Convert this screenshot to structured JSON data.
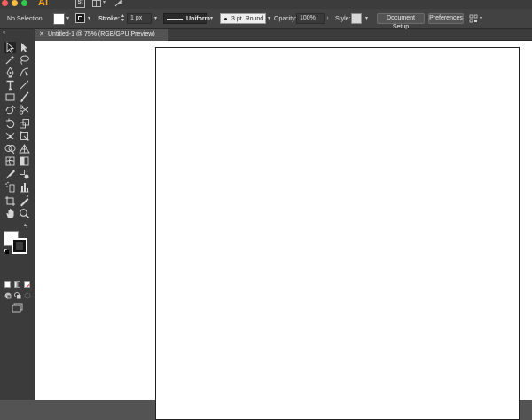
{
  "app": {
    "logo_text": "Ai",
    "stock_text": "St"
  },
  "control_bar": {
    "selection_status": "No Selection",
    "stroke_label": "Stroke:",
    "stroke_weight": "1 px",
    "stroke_profile": "Uniform",
    "brush": "3 pt. Round",
    "opacity_label": "Opacity:",
    "opacity_value": "100%",
    "style_label": "Style:",
    "document_setup_label": "Document Setup",
    "preferences_label": "Preferences"
  },
  "document_tab": {
    "close_glyph": "✕",
    "title": "Untitled-1 @ 75% (RGB/GPU Preview)"
  },
  "colors": {
    "fill": "#ffffff",
    "stroke": "#000000",
    "style": "#d9d9d9",
    "brand": "#f6a623"
  },
  "tools": [
    "selection-tool",
    "direct-selection-tool",
    "magic-wand-tool",
    "lasso-tool",
    "pen-tool",
    "curvature-tool",
    "type-tool",
    "line-segment-tool",
    "rectangle-tool",
    "paintbrush-tool",
    "shaper-tool",
    "scissors-tool",
    "rotate-tool",
    "scale-tool",
    "width-tool",
    "free-transform-tool",
    "shape-builder-tool",
    "perspective-grid-tool",
    "mesh-tool",
    "gradient-tool",
    "eyedropper-tool",
    "blend-tool",
    "symbol-sprayer-tool",
    "column-graph-tool",
    "artboard-tool",
    "slice-tool",
    "hand-tool",
    "zoom-tool"
  ]
}
